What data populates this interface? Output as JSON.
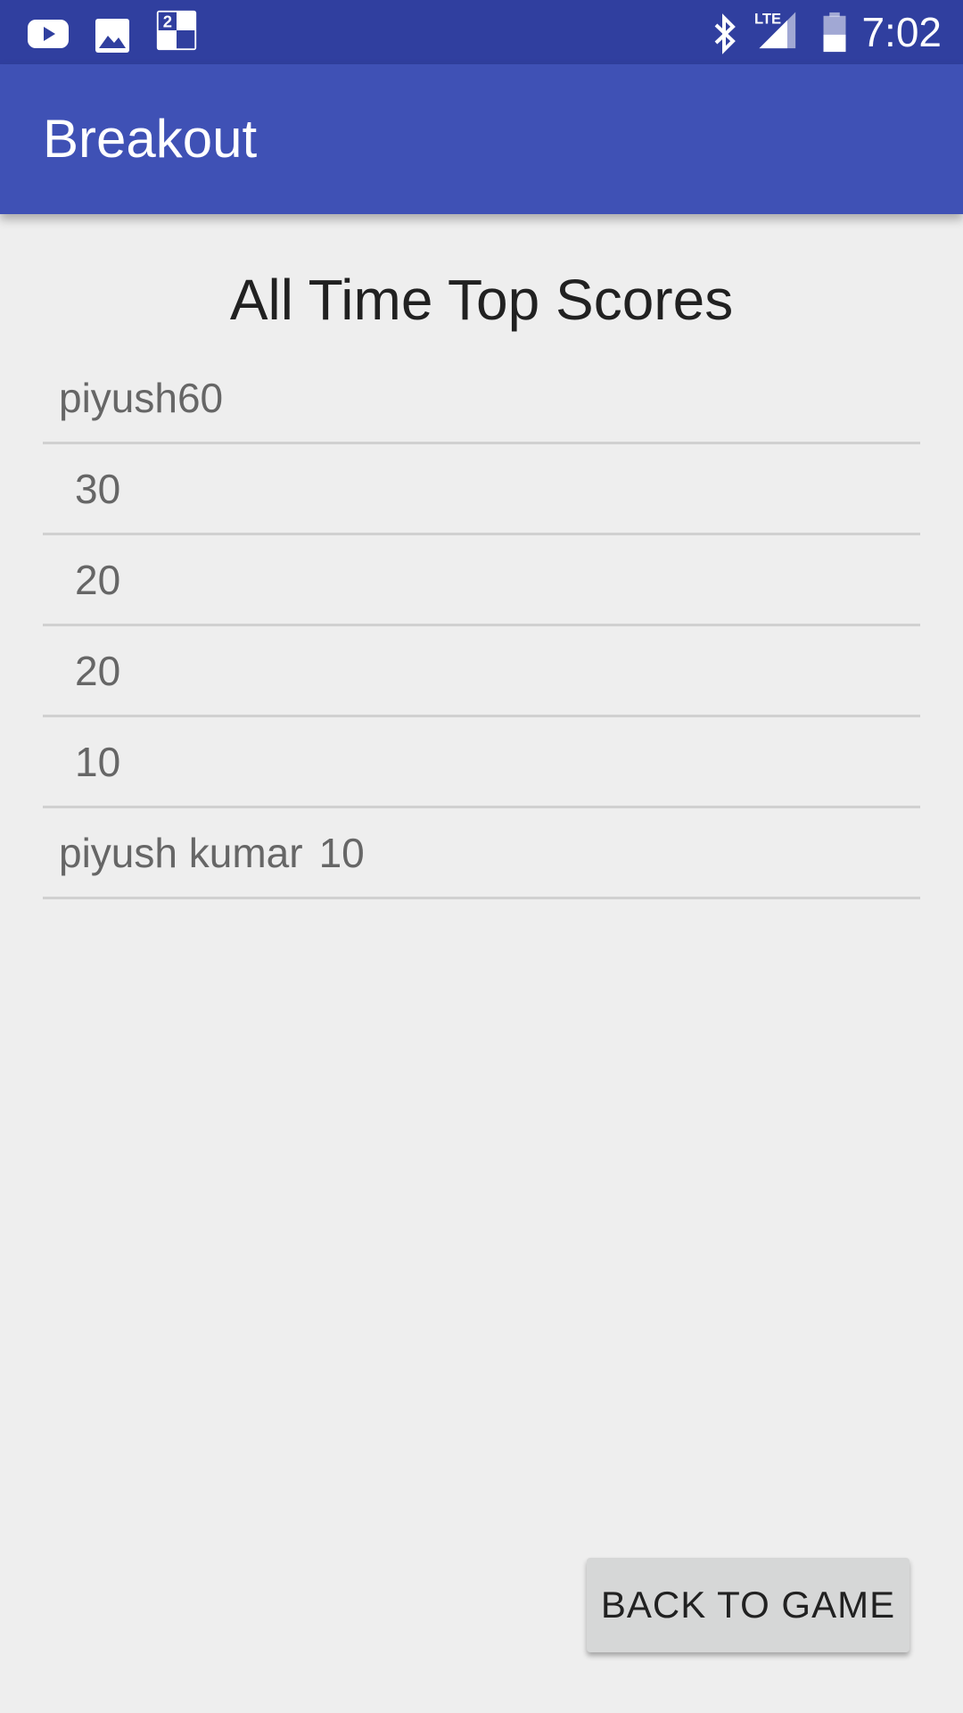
{
  "status_bar": {
    "time": "7:02",
    "left_icons": [
      "youtube-icon",
      "image-icon",
      "game-notification-icon"
    ],
    "right_icons": [
      "bluetooth-icon",
      "lte-signal-icon",
      "battery-icon"
    ],
    "lte_label": "LTE",
    "notification_badge": "2"
  },
  "app_bar": {
    "title": "Breakout"
  },
  "main": {
    "heading": "All Time Top Scores",
    "scores": [
      {
        "name": "piyush",
        "score": "60"
      },
      {
        "name": "",
        "score": "30"
      },
      {
        "name": "",
        "score": "20"
      },
      {
        "name": "",
        "score": "20"
      },
      {
        "name": "",
        "score": "10"
      },
      {
        "name": "piyush kumar",
        "score": "10"
      }
    ],
    "back_button_label": "BACK TO GAME"
  },
  "colors": {
    "status_bar": "#303F9F",
    "app_bar": "#3F51B5",
    "background": "#EEEEEE",
    "button": "#D6D7D7"
  }
}
